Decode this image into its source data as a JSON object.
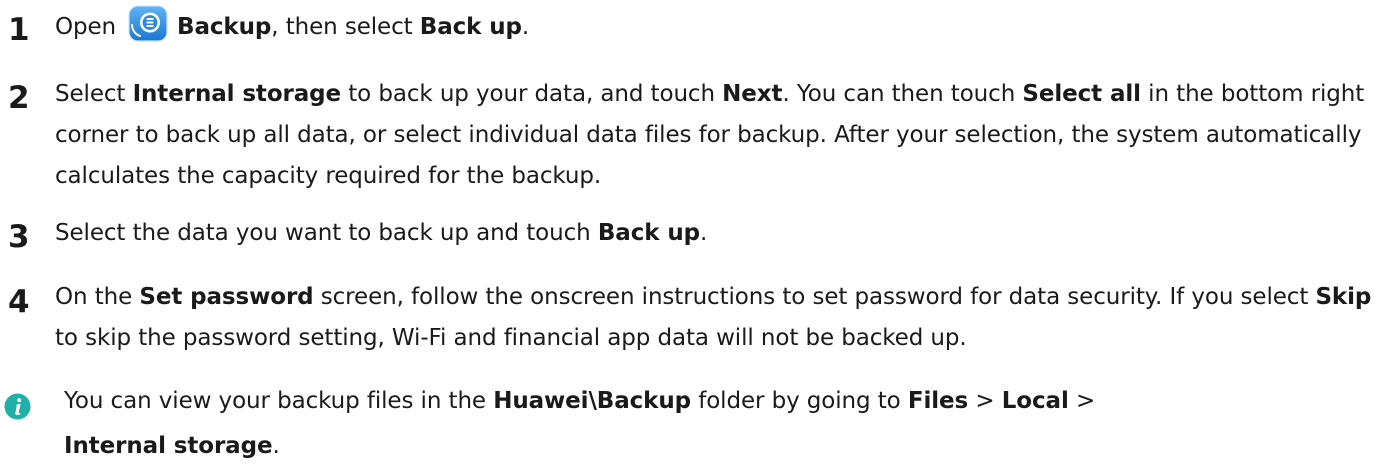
{
  "steps": [
    {
      "number": "1",
      "open": "Open",
      "app": "Backup",
      "mid": ", then select ",
      "action": "Back up",
      "end": "."
    },
    {
      "number": "2",
      "t1": "Select ",
      "b1": "Internal storage",
      "t2": " to back up your data, and touch ",
      "b2": "Next",
      "t3": ". You can then touch ",
      "b3": "Select all",
      "t4": " in the bottom right corner to back up all data, or select individual data files for backup. After your selection, the system automatically calculates the capacity required for the backup."
    },
    {
      "number": "3",
      "t1": "Select the data you want to back up and touch ",
      "b1": "Back up",
      "t2": "."
    },
    {
      "number": "4",
      "t1": "On the ",
      "b1": "Set password",
      "t2": " screen, follow the onscreen instructions to set password for data security. If you select ",
      "b2": "Skip",
      "t3": " to skip the password setting, Wi-Fi and financial app data will not be backed up."
    }
  ],
  "note": {
    "icon": "info-icon",
    "t1": "You can view your backup files in the ",
    "b1": "Huawei\\Backup",
    "t2": " folder by going to ",
    "b2": "Files",
    "sep1": " > ",
    "b3": "Local",
    "sep2": " >",
    "b4": "Internal storage",
    "end": "."
  },
  "colors": {
    "text": "#1a1a1a",
    "info_icon": "#1fb0a8",
    "app_icon": "#1e88e5"
  }
}
